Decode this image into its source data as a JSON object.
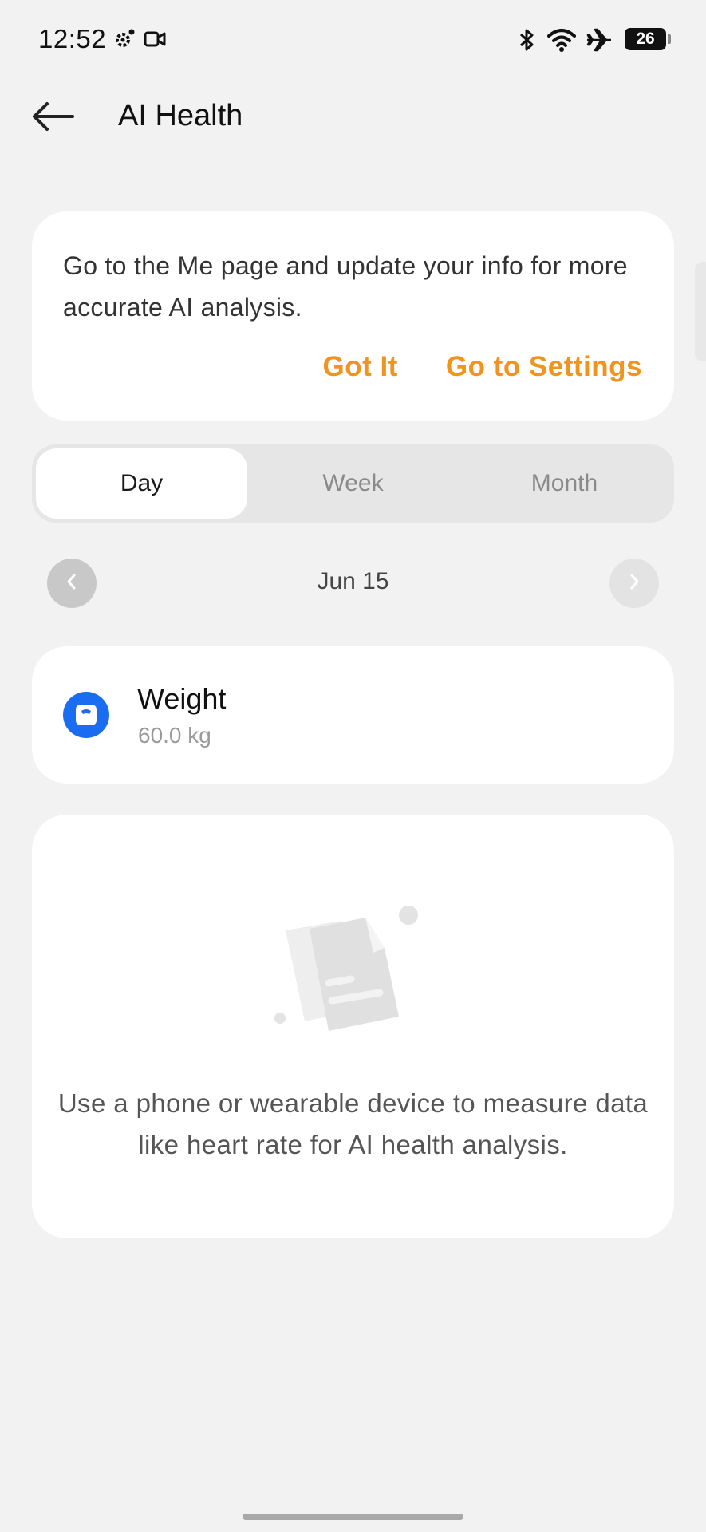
{
  "status_bar": {
    "time": "12:52",
    "battery": "26",
    "icons": [
      "settings-gear-icon",
      "video-camera-icon",
      "bluetooth-icon",
      "wifi-icon",
      "airplane-mode-icon",
      "battery-icon"
    ]
  },
  "header": {
    "title": "AI Health",
    "back_icon": "arrow-left-icon"
  },
  "prompt": {
    "message": "Go to the Me page and update your info for more accurate AI analysis.",
    "got_it": "Got It",
    "go_to_settings": "Go to Settings",
    "accent_color": "#f0941f"
  },
  "range_tabs": {
    "items": [
      "Day",
      "Week",
      "Month"
    ],
    "selected": "Day"
  },
  "date_nav": {
    "date": "Jun 15",
    "prev_icon": "chevron-left-icon",
    "next_icon": "chevron-right-icon"
  },
  "weight": {
    "title": "Weight",
    "value": "60.0 kg",
    "icon": "scale-icon",
    "icon_color": "#1a6cf0"
  },
  "empty_state": {
    "icon": "document-illustration-icon",
    "message": "Use a phone or wearable device to measure data like heart rate for AI health analysis."
  }
}
